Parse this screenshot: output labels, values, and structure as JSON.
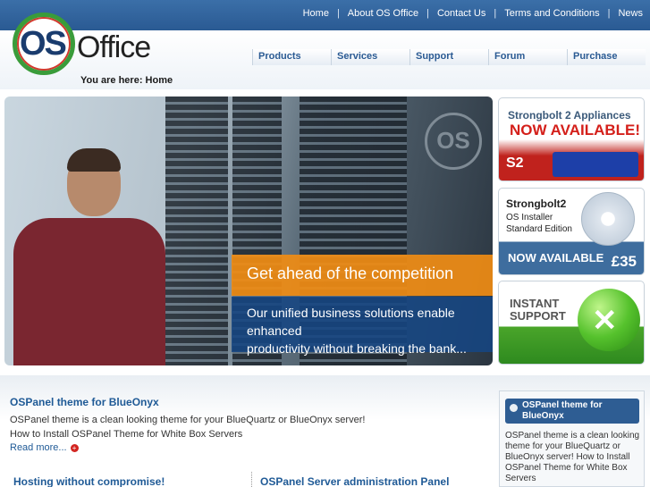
{
  "topnav": {
    "items": [
      "Home",
      "About OS Office",
      "Contact Us",
      "Terms and Conditions",
      "News"
    ],
    "separator": "|"
  },
  "logo": {
    "os": "OS",
    "office": "Office"
  },
  "breadcrumb": "You are here: Home",
  "mainnav": [
    "Products",
    "Services",
    "Support",
    "Forum",
    "Purchase"
  ],
  "hero": {
    "badge": "OS",
    "headline": "Get ahead of the competition",
    "body_line1": "Our unified business solutions enable enhanced",
    "body_line2": "productivity without breaking the bank..."
  },
  "promos": [
    {
      "line1": "Strongbolt 2 Appliances",
      "line2": "NOW AVAILABLE!",
      "logo": "S2"
    },
    {
      "line1": "Strongbolt2",
      "line2": "OS Installer",
      "line3": "Standard Edition",
      "cta": "NOW AVAILABLE",
      "price": "£35"
    },
    {
      "line1": "INSTANT",
      "line2": "SUPPORT"
    }
  ],
  "main": {
    "title": "OSPanel theme for BlueOnyx",
    "line1": "OSPanel theme is a clean looking theme for your BlueQuartz or BlueOnyx server!",
    "line2": "How to Install OSPanel Theme for White Box Servers",
    "readmore": "Read more..."
  },
  "columns": {
    "left_title": "Hosting without compromise!",
    "right_title": "OSPanel Server administration Panel"
  },
  "sidebar_news": {
    "title": "OSPanel theme for BlueOnyx",
    "body": "OSPanel theme is a clean looking theme for your BlueQuartz or BlueOnyx server! How to Install OSPanel Theme for White Box Servers"
  },
  "colors": {
    "topbar": "#2a5a93",
    "link": "#1f5a96",
    "orange": "#f08c14",
    "red": "#d41f1a",
    "green": "#4aa52a"
  }
}
